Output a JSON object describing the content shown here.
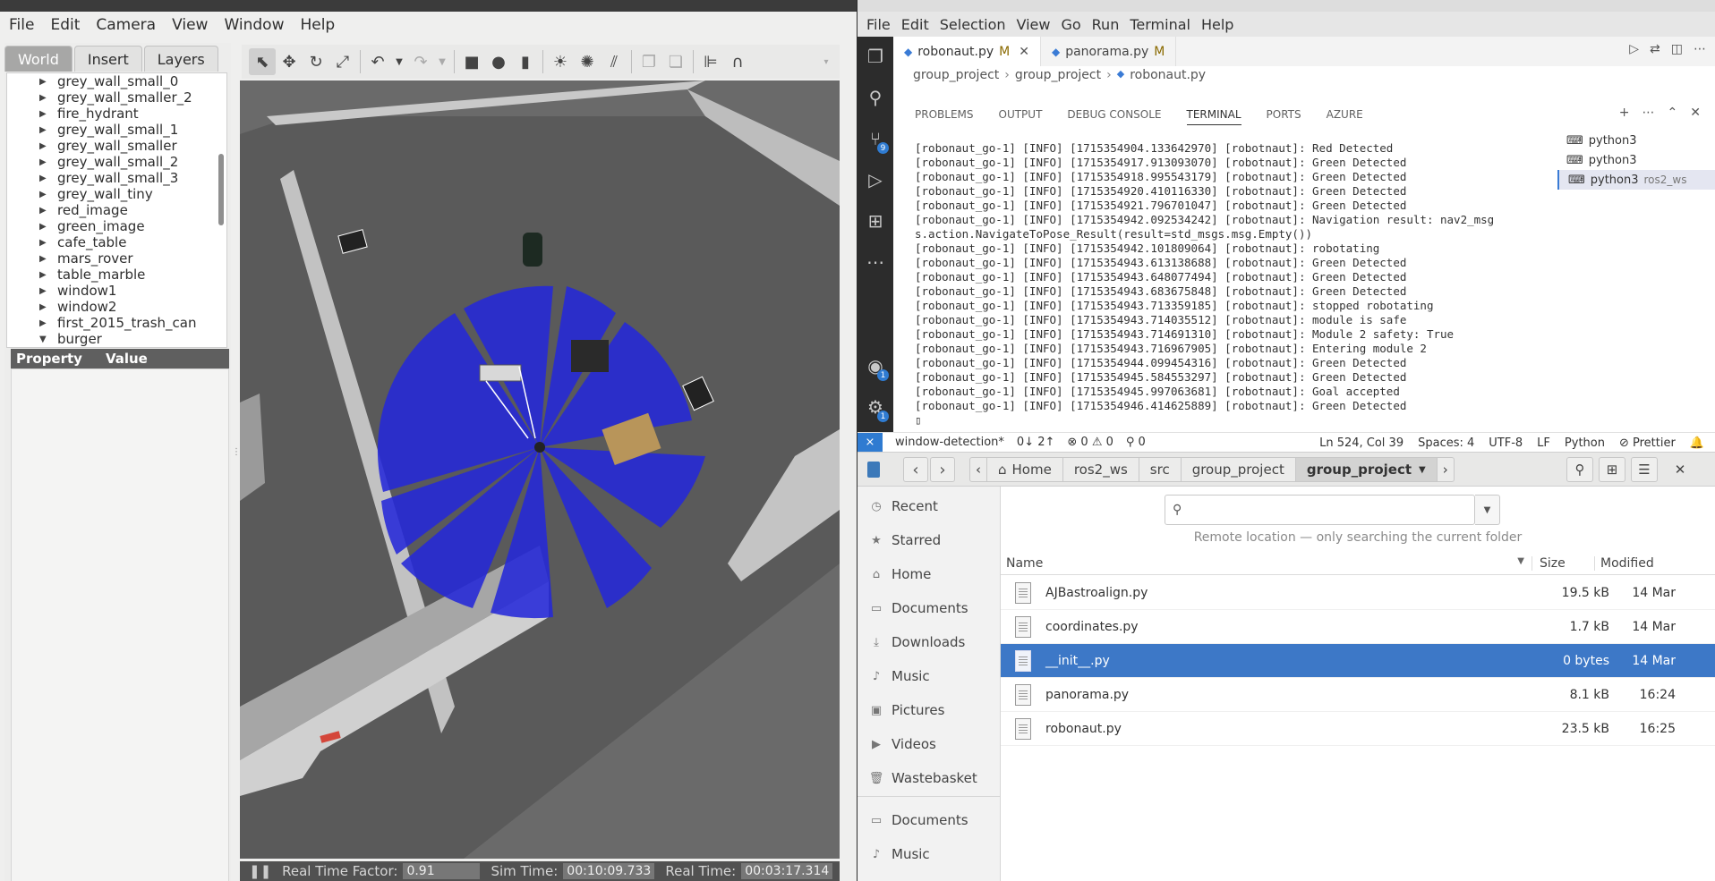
{
  "gazebo": {
    "menu": [
      "File",
      "Edit",
      "Camera",
      "View",
      "Window",
      "Help"
    ],
    "tabs": [
      "World",
      "Insert",
      "Layers"
    ],
    "tree_items": [
      "grey_wall_small_0",
      "grey_wall_smaller_2",
      "fire_hydrant",
      "grey_wall_small_1",
      "grey_wall_smaller",
      "grey_wall_small_2",
      "grey_wall_small_3",
      "grey_wall_tiny",
      "red_image",
      "green_image",
      "cafe_table",
      "mars_rover",
      "table_marble",
      "window1",
      "window2",
      "first_2015_trash_can",
      "burger"
    ],
    "property_header": "Property",
    "value_header": "Value",
    "status": {
      "rtf_label": "Real Time Factor:",
      "rtf_value": "0.91",
      "sim_label": "Sim Time:",
      "sim_value": "00:10:09.733",
      "real_label": "Real Time:",
      "real_value": "00:03:17.314"
    }
  },
  "vscode": {
    "menu": [
      "File",
      "Edit",
      "Selection",
      "View",
      "Go",
      "Run",
      "Terminal",
      "Help"
    ],
    "tabs": [
      {
        "name": "robonaut.py",
        "mod": "M"
      },
      {
        "name": "panorama.py",
        "mod": "M"
      }
    ],
    "breadcrumb": [
      "group_project",
      "group_project",
      "robonaut.py"
    ],
    "panel_tabs": [
      "PROBLEMS",
      "OUTPUT",
      "DEBUG CONSOLE",
      "TERMINAL",
      "PORTS",
      "AZURE"
    ],
    "terminal_lines": [
      "[robonaut_go-1] [INFO] [1715354904.133642970] [robotnaut]: Red Detected",
      "[robonaut_go-1] [INFO] [1715354917.913093070] [robotnaut]: Green Detected",
      "[robonaut_go-1] [INFO] [1715354918.995543179] [robotnaut]: Green Detected",
      "[robonaut_go-1] [INFO] [1715354920.410116330] [robotnaut]: Green Detected",
      "[robonaut_go-1] [INFO] [1715354921.796701047] [robotnaut]: Green Detected",
      "[robonaut_go-1] [INFO] [1715354942.092534242] [robotnaut]: Navigation result: nav2_msg",
      "s.action.NavigateToPose_Result(result=std_msgs.msg.Empty())",
      "[robonaut_go-1] [INFO] [1715354942.101809064] [robotnaut]: robotating",
      "[robonaut_go-1] [INFO] [1715354943.613138688] [robotnaut]: Green Detected",
      "[robonaut_go-1] [INFO] [1715354943.648077494] [robotnaut]: Green Detected",
      "[robonaut_go-1] [INFO] [1715354943.683675848] [robotnaut]: Green Detected",
      "[robonaut_go-1] [INFO] [1715354943.713359185] [robotnaut]: stopped robotating",
      "[robonaut_go-1] [INFO] [1715354943.714035512] [robotnaut]: module is safe",
      "[robonaut_go-1] [INFO] [1715354943.714691310] [robotnaut]: Module 2 safety: True",
      "[robonaut_go-1] [INFO] [1715354943.716967905] [robotnaut]: Entering module 2",
      "[robonaut_go-1] [INFO] [1715354944.099454316] [robotnaut]: Green Detected",
      "[robonaut_go-1] [INFO] [1715354945.584553297] [robotnaut]: Green Detected",
      "[robonaut_go-1] [INFO] [1715354945.997063681] [robotnaut]: Goal accepted",
      "[robonaut_go-1] [INFO] [1715354946.414625889] [robotnaut]: Green Detected"
    ],
    "terminals": [
      {
        "name": "python3",
        "sub": ""
      },
      {
        "name": "python3",
        "sub": ""
      },
      {
        "name": "python3",
        "sub": "ros2_ws"
      }
    ],
    "status": {
      "branch": "window-detection*",
      "sync": "0↓ 2↑",
      "problems": "⊗ 0 ⚠ 0",
      "ports": "⚲ 0",
      "position": "Ln 524, Col 39",
      "spaces": "Spaces: 4",
      "encoding": "UTF-8",
      "eol": "LF",
      "language": "Python",
      "prettier": "⊘ Prettier"
    },
    "badges": {
      "scm": "9",
      "accounts": "1",
      "settings": "1"
    }
  },
  "files": {
    "path": [
      "Home",
      "ros2_ws",
      "src",
      "group_project",
      "group_project"
    ],
    "sidebar": [
      {
        "icon": "clock-icon",
        "glyph": "◷",
        "label": "Recent"
      },
      {
        "icon": "star-icon",
        "glyph": "★",
        "label": "Starred"
      },
      {
        "icon": "home-icon",
        "glyph": "⌂",
        "label": "Home"
      },
      {
        "icon": "documents-icon",
        "glyph": "▭",
        "label": "Documents"
      },
      {
        "icon": "downloads-icon",
        "glyph": "⤓",
        "label": "Downloads"
      },
      {
        "icon": "music-icon",
        "glyph": "♪",
        "label": "Music"
      },
      {
        "icon": "pictures-icon",
        "glyph": "▣",
        "label": "Pictures"
      },
      {
        "icon": "videos-icon",
        "glyph": "▶",
        "label": "Videos"
      },
      {
        "icon": "trash-icon",
        "glyph": "🗑",
        "label": "Wastebasket"
      },
      {
        "icon": "documents-icon",
        "glyph": "▭",
        "label": "Documents"
      },
      {
        "icon": "music-icon",
        "glyph": "♪",
        "label": "Music"
      }
    ],
    "search_placeholder": "",
    "remote_note": "Remote location — only searching the current folder",
    "columns": {
      "name": "Name",
      "size": "Size",
      "modified": "Modified"
    },
    "rows": [
      {
        "name": "AJBastroalign.py",
        "size": "19.5 kB",
        "modified": "14 Mar"
      },
      {
        "name": "coordinates.py",
        "size": "1.7 kB",
        "modified": "14 Mar"
      },
      {
        "name": "__init__.py",
        "size": "0 bytes",
        "modified": "14 Mar",
        "selected": true
      },
      {
        "name": "panorama.py",
        "size": "8.1 kB",
        "modified": "16:24"
      },
      {
        "name": "robonaut.py",
        "size": "23.5 kB",
        "modified": "16:25"
      }
    ]
  },
  "colors": {
    "accent": "#3d78c7",
    "laser": "#2222dd",
    "vs_remote": "#2f7bd1"
  }
}
